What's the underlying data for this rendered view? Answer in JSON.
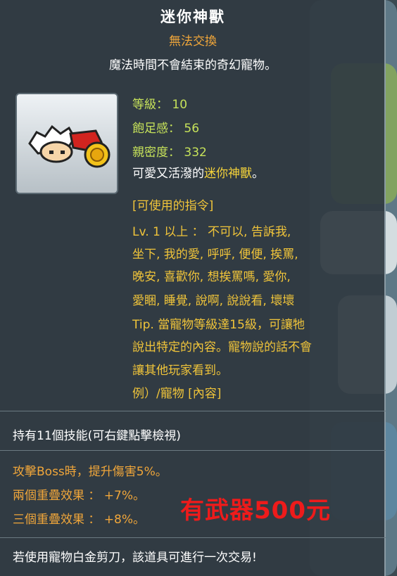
{
  "item": {
    "name": "迷你神獸",
    "trade_status": "無法交換",
    "description": "魔法時間不會結束的奇幻寵物。"
  },
  "stats": {
    "level": "等級： 10",
    "fullness": "飽足感： 56",
    "closeness": "親密度： 332"
  },
  "flavor": {
    "prefix": "可愛又活潑的",
    "name": "迷你神獸",
    "suffix": "。"
  },
  "commands": {
    "header": "[可使用的指令]",
    "lines": [
      "Lv. 1 以上 ： 不可以, 告訴我,",
      "坐下, 我的愛, 呼呼, 便便, 挨罵,",
      "晚安, 喜歡你, 想挨罵嗎, 愛你,",
      "愛睏, 睡覺, 說啊, 說說看, 壞壞",
      "Tip. 當寵物等級達15級，可讓牠",
      "說出特定的內容。寵物說的話不會",
      "讓其他玩家看到。",
      "例）/寵物 [內容]"
    ]
  },
  "skills": {
    "summary": "持有11個技能(可右鍵點擊檢視)",
    "boss": "攻擊Boss時，提升傷害5%。",
    "two_stack": "兩個重疊效果 ： +7%。",
    "three_stack": "三個重疊效果 ： +8%。"
  },
  "promo_text": "有武器500元",
  "scissors_note": "若使用寵物白金剪刀，該道具可進行一次交易!",
  "colors": {
    "stat_green": "#c6e25a",
    "command_gold": "#f0c43a",
    "skill_orange": "#f0a63a",
    "promo_red": "#ee1b1b"
  }
}
